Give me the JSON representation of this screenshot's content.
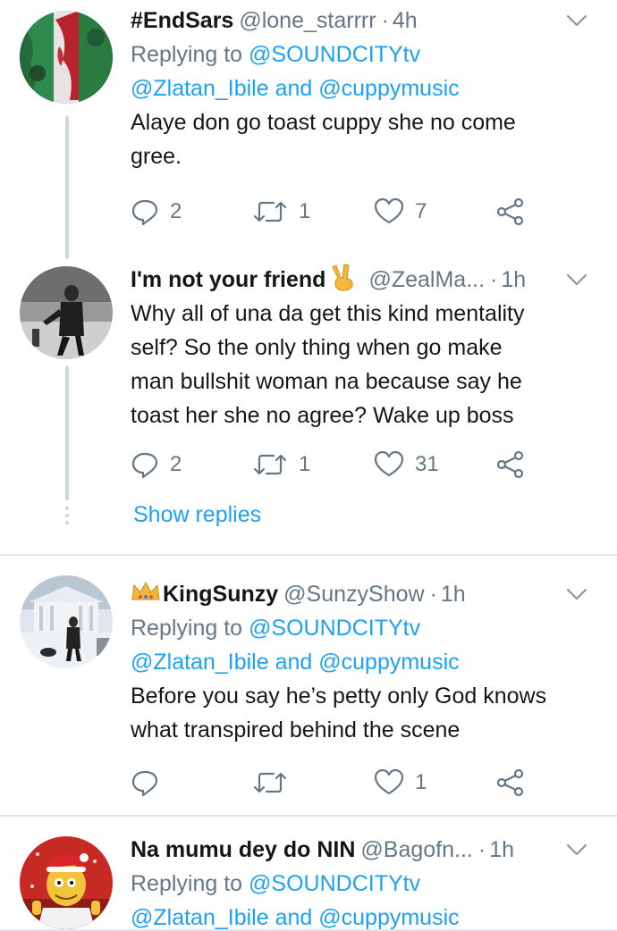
{
  "tweets": [
    {
      "name": "#EndSars",
      "handle": "@lone_starrrr",
      "sep": "·",
      "time": "4h",
      "replying_label": "Replying to",
      "replying_to_1": "@SOUNDCITYtv",
      "replying_to_2": "@Zlatan_Ibile",
      "replying_and": "and",
      "replying_to_3": "@cuppymusic",
      "text_lines": [
        "Alaye don go toast cuppy she no come",
        "gree."
      ],
      "replies": "2",
      "retweets": "1",
      "likes": "7"
    },
    {
      "name": "I'm not your friend",
      "handle": "@ZealMa...",
      "sep": "·",
      "time": "1h",
      "text_lines": [
        "Why all of una da get this kind mentality",
        "self? So the only thing when go make",
        "man bullshit woman na because say he",
        "toast her she no agree? Wake up boss"
      ],
      "replies": "2",
      "retweets": "1",
      "likes": "31",
      "show_replies": "Show replies"
    },
    {
      "name": "KingSunzy",
      "handle": "@SunzyShow",
      "sep": "·",
      "time": "1h",
      "replying_label": "Replying to",
      "replying_to_1": "@SOUNDCITYtv",
      "replying_to_2": "@Zlatan_Ibile",
      "replying_and": "and",
      "replying_to_3": "@cuppymusic",
      "text_lines": [
        "Before you say he’s petty only God knows",
        "what transpired behind the scene"
      ],
      "likes": "1"
    },
    {
      "name": "Na mumu dey do NIN",
      "handle": "@Bagofn...",
      "sep": "·",
      "time": "1h",
      "replying_label": "Replying to",
      "replying_to_1": "@SOUNDCITYtv",
      "replying_to_2": "@Zlatan_Ibile",
      "replying_and": "and",
      "replying_to_3": "@cuppymusic"
    }
  ],
  "colors": {
    "accent": "#1da1f2",
    "secondary_text": "#657786",
    "divider": "#e1e8ed",
    "thread_line": "#ccd6dd"
  },
  "icons": [
    "reply-icon",
    "retweet-icon",
    "like-icon",
    "share-icon",
    "chevron-down-icon",
    "victory-hand-emoji",
    "crown-emoji"
  ]
}
